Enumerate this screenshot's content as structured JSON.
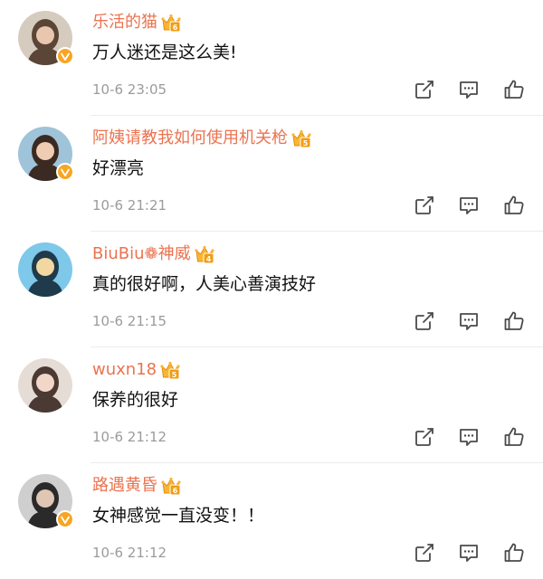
{
  "colors": {
    "username": "#eb7350",
    "text": "#111111",
    "time": "#9b9b9b",
    "icon": "#4a4a4a",
    "badge": "#f6a623",
    "divider": "#ececec"
  },
  "icons": {
    "share": "share-icon",
    "reply": "comment-icon",
    "like": "thumbs-up-icon",
    "verified": "verified-badge-icon",
    "member": "crown-badge-icon"
  },
  "comments": [
    {
      "username": "乐活的猫",
      "level": "6",
      "text": "万人迷还是这么美!",
      "time": "10-6 23:05",
      "verified": true,
      "avatar_palette": [
        "#d6cbbf",
        "#5a4536",
        "#e8c7ae"
      ]
    },
    {
      "username": "阿姨请教我如何使用机关枪",
      "level": "5",
      "text": "好漂亮",
      "time": "10-6 21:21",
      "verified": true,
      "avatar_palette": [
        "#9fc3d9",
        "#3b2a22",
        "#f0cdb2"
      ]
    },
    {
      "username": "BiuBiu❁神威",
      "level": "4",
      "text": "真的很好啊，人美心善演技好",
      "time": "10-6 21:15",
      "verified": false,
      "avatar_palette": [
        "#7ec8ea",
        "#1f3a4a",
        "#f3d7a0"
      ]
    },
    {
      "username": "wuxn18",
      "level": "5",
      "text": "保养的很好",
      "time": "10-6 21:12",
      "verified": false,
      "avatar_palette": [
        "#e6dcd6",
        "#4a3a33",
        "#f2d6c8"
      ]
    },
    {
      "username": "路遇黄昏",
      "level": "6",
      "text": "女神感觉一直没变！！",
      "time": "10-6 21:12",
      "verified": true,
      "avatar_palette": [
        "#cfcfcf",
        "#2a2a2a",
        "#e0c6b4"
      ]
    }
  ]
}
